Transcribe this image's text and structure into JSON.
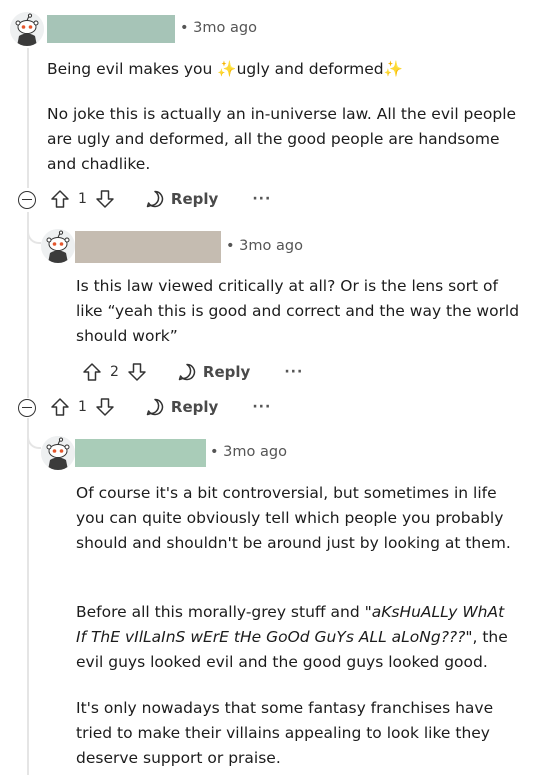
{
  "colors": {
    "redact_1": "#a6c4b7",
    "redact_2": "#c5bcb1",
    "redact_3": "#a9ccb8"
  },
  "comments": [
    {
      "time": "3mo ago",
      "body_pre": "Being evil makes you ",
      "sparkle": "✨",
      "body_mid": "ugly and deformed",
      "body_post": "✨",
      "para2": "No joke this is actually an in-universe law. All the evil people are ugly and deformed, all the good people are handsome and chadlike.",
      "votes": "1",
      "reply_label": "Reply",
      "more": "···"
    },
    {
      "time": "3mo ago",
      "body": "Is this law viewed critically at all? Or is the lens sort of like “yeah this is good and correct and the way the world should work”",
      "votes": "2",
      "reply_label": "Reply",
      "more": "···"
    },
    {
      "votes": "1",
      "reply_label": "Reply",
      "more": "···"
    },
    {
      "time": "3mo ago",
      "para1": "Of course it's a bit controversial, but sometimes in life you can quite obviously tell which people you probably should and shouldn't be around just by looking at them.",
      "para2_pre": "Before all this morally-grey stuff and \"",
      "para2_italic": "aKsHuALLy WhAt If ThE vIlLaInS wErE tHe GoOd GuYs ALL aLoNg???",
      "para2_post": "\", the evil guys looked evil and the good guys looked good.",
      "para3": "It's only nowadays that some fantasy franchises have tried to make their villains appealing to look like they deserve support or praise."
    }
  ]
}
